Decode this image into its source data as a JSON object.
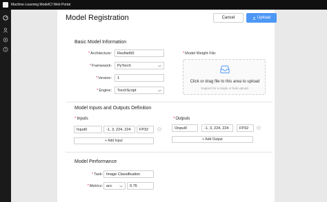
{
  "window": {
    "title": "Machine-Learning ModelCI Web Portal"
  },
  "sidebar": {
    "icons": [
      "dashboard-icon",
      "user-icon",
      "settings-icon",
      "help-icon"
    ]
  },
  "header": {
    "title": "Model Registration",
    "cancel_label": "Cancel",
    "upload_label": "Upload"
  },
  "basic": {
    "title": "Basic Model Information",
    "architecture": {
      "label": "Architecture:",
      "value": "ResNet50"
    },
    "framework": {
      "label": "Framework:",
      "value": "PyTorch"
    },
    "version": {
      "label": "Version:",
      "value": "1"
    },
    "engine": {
      "label": "Engine:",
      "value": "TorchScript"
    },
    "weight": {
      "label": "Model Weight File:",
      "drop_text": "Click or drag file to this area to upload",
      "drop_hint": "Support for a single or bulk upload."
    }
  },
  "io": {
    "title": "Model Inputs and Outputs Definition",
    "inputs": {
      "label": "Inputs",
      "name": "Input0",
      "shape": "-1, 3, 224, 224",
      "dtype": "FP32",
      "add_label": "+ Add Input"
    },
    "outputs": {
      "label": "Outputs",
      "name": "Onput0",
      "shape": "-1, 3, 224, 224",
      "dtype": "FP32",
      "add_label": "+ Add Output"
    }
  },
  "performance": {
    "title": "Model Performance",
    "task": {
      "label": "Task:",
      "value": "Image Classification"
    },
    "metrics": {
      "label": "Metrics:",
      "metric": "acc",
      "value": "0.76"
    }
  },
  "colors": {
    "primary": "#4d97f5",
    "required": "#e23",
    "topbar": "#101010",
    "sidebar": "#1a1a1a"
  }
}
